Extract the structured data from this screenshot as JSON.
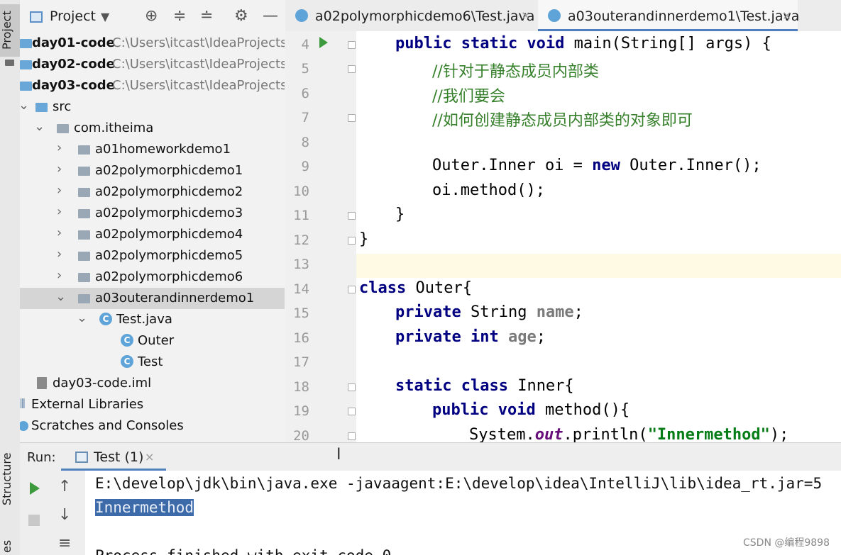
{
  "sidebar": {
    "project_tab": "Project",
    "structure_tab": "Structure",
    "es_tab": "es"
  },
  "project": {
    "title": "Project",
    "tree": [
      {
        "label": "day01-code",
        "path": "C:\\Users\\itcast\\IdeaProjects\\"
      },
      {
        "label": "day02-code",
        "path": "C:\\Users\\itcast\\IdeaProjects\\"
      },
      {
        "label": "day03-code",
        "path": "C:\\Users\\itcast\\IdeaProjects\\"
      },
      {
        "label": "src"
      },
      {
        "label": "com.itheima"
      },
      {
        "label": "a01homeworkdemo1"
      },
      {
        "label": "a02polymorphicdemo1"
      },
      {
        "label": "a02polymorphicdemo2"
      },
      {
        "label": "a02polymorphicdemo3"
      },
      {
        "label": "a02polymorphicdemo4"
      },
      {
        "label": "a02polymorphicdemo5"
      },
      {
        "label": "a02polymorphicdemo6"
      },
      {
        "label": "a03outerandinnerdemo1"
      },
      {
        "label": "Test.java"
      },
      {
        "label": "Outer"
      },
      {
        "label": "Test"
      },
      {
        "label": "day03-code.iml"
      },
      {
        "label": "External Libraries"
      },
      {
        "label": "Scratches and Consoles"
      }
    ]
  },
  "tabs": [
    {
      "label": "a02polymorphicdemo6\\Test.java"
    },
    {
      "label": "a03outerandinnerdemo1\\Test.java"
    }
  ],
  "editor": {
    "line_numbers": [
      "4",
      "5",
      "6",
      "7",
      "8",
      "9",
      "10",
      "11",
      "12",
      "13",
      "14",
      "15",
      "16",
      "17",
      "18",
      "19",
      "20"
    ],
    "code": {
      "l4a": "public static void",
      "l4b": " main(String[] args) {",
      "l5": "//针对于静态成员内部类",
      "l6": "//我们要会",
      "l7": "//如何创建静态成员内部类的对象即可",
      "l9a": "Outer.Inner oi = ",
      "l9b": "new",
      "l9c": " Outer.Inner();",
      "l10": "oi.method();",
      "l11": "}",
      "l12": "}",
      "l14a": "class",
      "l14b": " Outer{",
      "l15a": "private",
      "l15b": " String ",
      "l15c": "name",
      "l15d": ";",
      "l16a": "private int",
      "l16b": " ",
      "l16c": "age",
      "l16d": ";",
      "l18a": "static class",
      "l18b": " Inner{",
      "l19a": "public void",
      "l19b": " method(){",
      "l20a": "System.",
      "l20b": "out",
      "l20c": ".println(",
      "l20d": "\"Innermethod\"",
      "l20e": ");"
    }
  },
  "run": {
    "label": "Run:",
    "tab": "Test (1)",
    "console": [
      "E:\\develop\\jdk\\bin\\java.exe -javaagent:E:\\develop\\idea\\IntelliJ\\lib\\idea_rt.jar=5",
      "Innermethod",
      "",
      "Process finished with exit code 0"
    ]
  },
  "watermark": "CSDN @编程9898",
  "icons": [
    "folder-icon",
    "class-icon",
    "run-icon",
    "close-icon",
    "gear-icon",
    "minus-icon",
    "target-icon",
    "expand-icon",
    "collapse-icon",
    "up-arrow-icon",
    "down-arrow-icon",
    "stop-icon"
  ]
}
